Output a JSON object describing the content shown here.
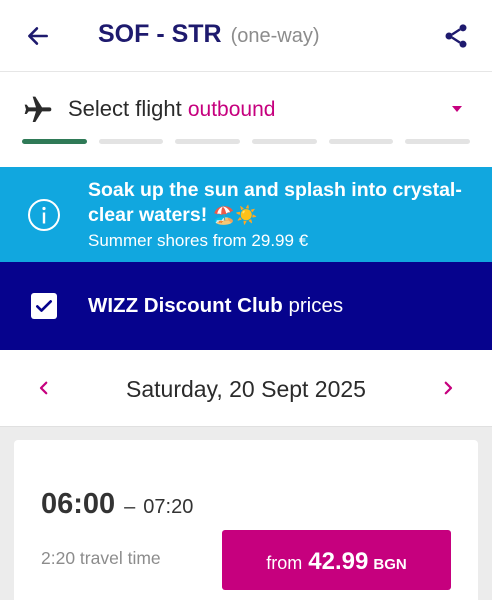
{
  "header": {
    "route": "SOF - STR",
    "trip_type": "(one-way)",
    "back_icon": "arrow-left-icon",
    "share_icon": "share-icon"
  },
  "flight_select": {
    "label": "Select flight",
    "direction": "outbound",
    "plane_icon": "airplane-icon",
    "steps_total": 6,
    "steps_completed": 1
  },
  "promo": {
    "headline": "Soak up the sun and splash into crystal-clear waters!",
    "emojis": "🏖️☀️",
    "subtext": "Summer shores from 29.99 €",
    "icon": "info-icon"
  },
  "discount": {
    "club_name": "WIZZ Discount Club",
    "suffix": "prices",
    "checked": true
  },
  "date": {
    "label": "Saturday, 20 Sept 2025"
  },
  "flight": {
    "depart": "06:00",
    "dash": "–",
    "arrive": "07:20",
    "travel_time": "2:20 travel time",
    "price_prefix": "from",
    "price": "42.99",
    "currency": "BGN"
  },
  "colors": {
    "brand_navy": "#06038d",
    "title_navy": "#1e1a6e",
    "accent_magenta": "#c6007e",
    "promo_blue": "#11a7df",
    "progress_green": "#2f7a57"
  }
}
